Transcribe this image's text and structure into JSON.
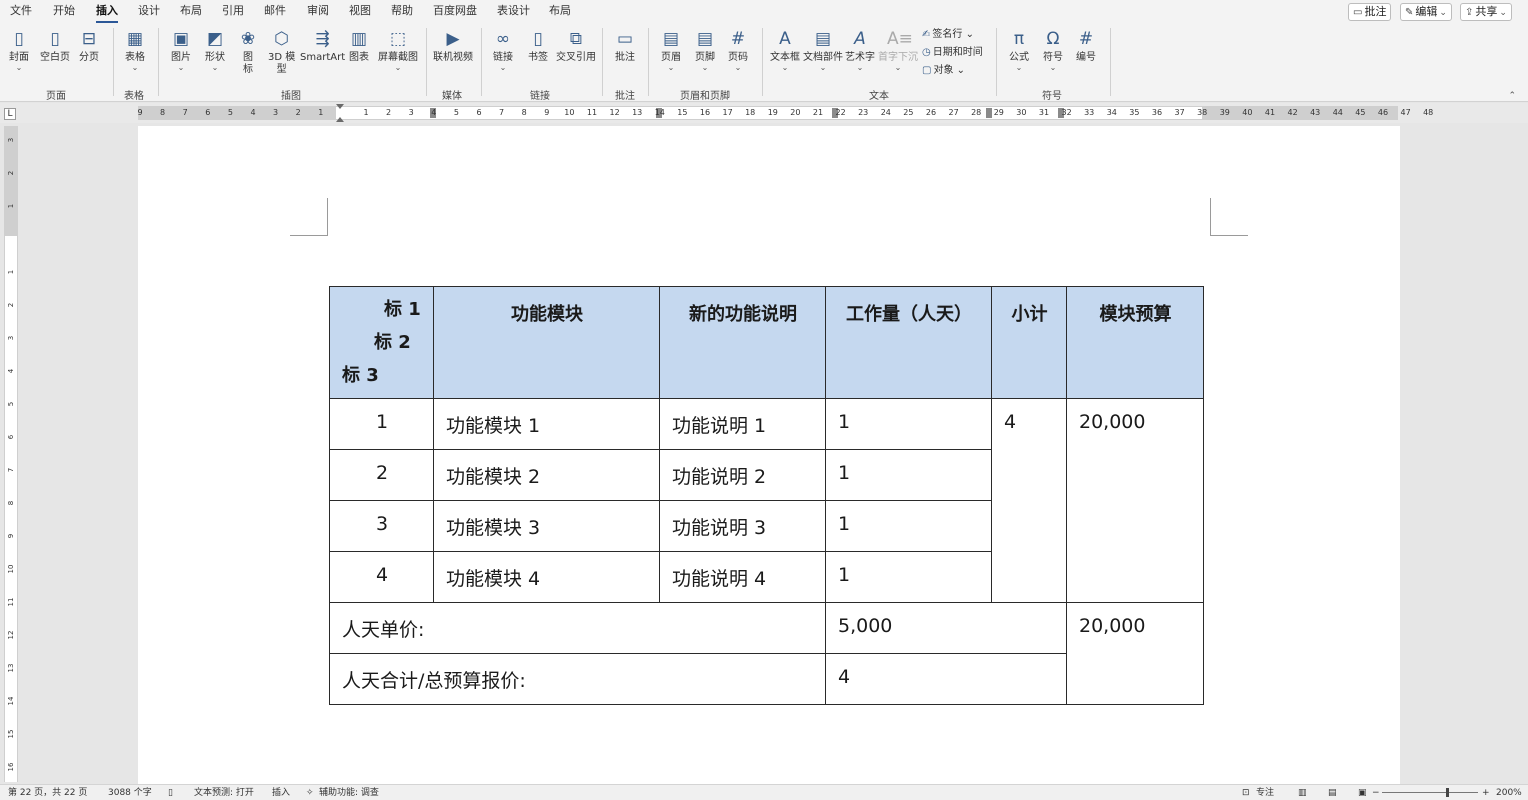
{
  "menu": {
    "tabs": [
      "文件",
      "开始",
      "插入",
      "设计",
      "布局",
      "引用",
      "邮件",
      "审阅",
      "视图",
      "帮助",
      "百度网盘",
      "表设计",
      "布局"
    ],
    "active_index": 2,
    "right_buttons": [
      {
        "icon": "comment-icon",
        "label": "批注"
      },
      {
        "icon": "pencil-icon",
        "label": "编辑"
      },
      {
        "icon": "share-icon",
        "label": "共享"
      }
    ]
  },
  "ribbon": {
    "buttons": [
      {
        "id": "cover",
        "label": "封面",
        "icon": "cover-page-icon",
        "dropdown": true
      },
      {
        "id": "blank",
        "label": "空白页",
        "icon": "blank-page-icon",
        "dropdown": false
      },
      {
        "id": "break",
        "label": "分页",
        "icon": "page-break-icon",
        "dropdown": false
      },
      {
        "id": "table",
        "label": "表格",
        "icon": "table-icon",
        "dropdown": true
      },
      {
        "id": "picture",
        "label": "图片",
        "icon": "picture-icon",
        "dropdown": true
      },
      {
        "id": "shapes",
        "label": "形状",
        "icon": "shapes-icon",
        "dropdown": true
      },
      {
        "id": "icons",
        "label": "图\n标",
        "icon": "icons-icon",
        "dropdown": false
      },
      {
        "id": "model3d",
        "label": "3D 模\n型",
        "icon": "cube-icon",
        "dropdown": true
      },
      {
        "id": "smartart",
        "label": "SmartArt",
        "icon": "smartart-icon",
        "dropdown": false
      },
      {
        "id": "chart",
        "label": "图表",
        "icon": "chart-icon",
        "dropdown": false
      },
      {
        "id": "screenshot",
        "label": "屏幕截图",
        "icon": "screenshot-icon",
        "dropdown": true
      },
      {
        "id": "video",
        "label": "联机视频",
        "icon": "video-icon",
        "dropdown": false
      },
      {
        "id": "link",
        "label": "链接",
        "icon": "link-icon",
        "dropdown": true
      },
      {
        "id": "bookmark",
        "label": "书签",
        "icon": "bookmark-icon",
        "dropdown": false
      },
      {
        "id": "crossref",
        "label": "交叉引用",
        "icon": "cross-reference-icon",
        "dropdown": false
      },
      {
        "id": "comment",
        "label": "批注",
        "icon": "comment-icon",
        "dropdown": false
      },
      {
        "id": "header",
        "label": "页眉",
        "icon": "header-icon",
        "dropdown": true
      },
      {
        "id": "footer",
        "label": "页脚",
        "icon": "footer-icon",
        "dropdown": true
      },
      {
        "id": "pagenum",
        "label": "页码",
        "icon": "page-number-icon",
        "dropdown": true
      },
      {
        "id": "textbox",
        "label": "文本框",
        "icon": "textbox-icon",
        "dropdown": true
      },
      {
        "id": "quickparts",
        "label": "文档部件",
        "icon": "quick-parts-icon",
        "dropdown": true
      },
      {
        "id": "wordart",
        "label": "艺术字",
        "icon": "wordart-icon",
        "dropdown": true
      },
      {
        "id": "dropcap",
        "label": "首字下沉",
        "icon": "drop-cap-icon",
        "dropdown": true
      },
      {
        "id": "equation",
        "label": "公式",
        "icon": "pi-icon",
        "dropdown": true
      },
      {
        "id": "symbol",
        "label": "符号",
        "icon": "omega-icon",
        "dropdown": true
      },
      {
        "id": "numbering",
        "label": "编号",
        "icon": "numbering-icon",
        "dropdown": false
      }
    ],
    "small_buttons": [
      {
        "label": "签名行",
        "icon": "signature-icon",
        "dropdown": true
      },
      {
        "label": "日期和时间",
        "icon": "calendar-icon",
        "dropdown": false
      },
      {
        "label": "对象",
        "icon": "object-icon",
        "dropdown": true
      }
    ],
    "groups": [
      "页面",
      "表格",
      "插图",
      "媒体",
      "链接",
      "批注",
      "页眉和页脚",
      "文本",
      "符号"
    ]
  },
  "ruler": {
    "corner": "L",
    "h_ticks": [
      "9",
      "8",
      "7",
      "6",
      "5",
      "4",
      "3",
      "2",
      "1",
      "",
      "1",
      "2",
      "3",
      "4",
      "5",
      "6",
      "7",
      "8",
      "9",
      "10",
      "11",
      "12",
      "13",
      "14",
      "15",
      "16",
      "17",
      "18",
      "19",
      "20",
      "21",
      "22",
      "23",
      "24",
      "25",
      "26",
      "27",
      "28",
      "29",
      "30",
      "31",
      "32",
      "33",
      "34",
      "35",
      "36",
      "37",
      "38",
      "39",
      "40",
      "41",
      "42",
      "43",
      "44",
      "45",
      "46",
      "47",
      "48"
    ],
    "v_ticks": [
      "3",
      "2",
      "1",
      "",
      "1",
      "2",
      "3",
      "4",
      "5",
      "6",
      "7",
      "8",
      "9",
      "10",
      "11",
      "12",
      "13",
      "14",
      "15",
      "16"
    ]
  },
  "table": {
    "diag_header": [
      "标 1",
      "标 2",
      "标 3"
    ],
    "headers": [
      "功能模块",
      "新的功能说明",
      "工作量（人天）",
      "小计",
      "模块预算"
    ],
    "rows": [
      {
        "no": "1",
        "module": "功能模块 1",
        "desc": "功能说明 1",
        "effort": "1"
      },
      {
        "no": "2",
        "module": "功能模块 2",
        "desc": "功能说明 2",
        "effort": "1"
      },
      {
        "no": "3",
        "module": "功能模块 3",
        "desc": "功能说明 3",
        "effort": "1"
      },
      {
        "no": "4",
        "module": "功能模块 4",
        "desc": "功能说明 4",
        "effort": "1"
      }
    ],
    "subtotal": "4",
    "module_budget": "20,000",
    "unit_price_label": "人天单价:",
    "unit_price_value": "5,000",
    "total_label": "人天合计/总预算报价:",
    "total_value": "4",
    "grand_total": "20,000",
    "header_color": "#c5d8ef"
  },
  "status": {
    "page": "第 22 页，共 22 页",
    "words": "3088 个字",
    "prediction": "文本预测: 打开",
    "mode": "插入",
    "accessibility": "辅助功能: 调查",
    "focus": "专注",
    "zoom": "200%",
    "zoom_minus": "−",
    "zoom_plus": "+"
  }
}
